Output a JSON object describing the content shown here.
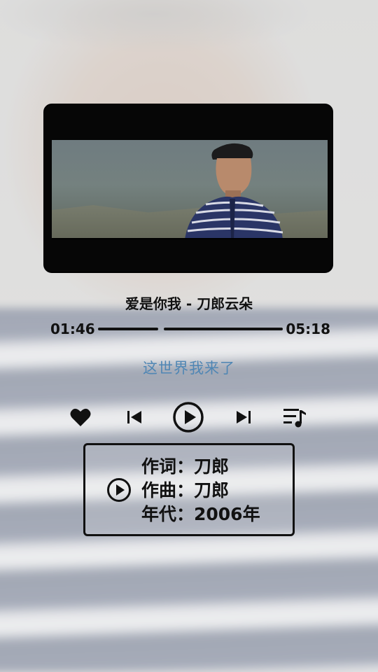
{
  "song": {
    "title": "爱是你我 - 刀郎云朵",
    "current_time": "01:46",
    "total_time": "05:18",
    "progress_fraction": 0.34,
    "lyric": "这世界我来了"
  },
  "controls": {
    "icons": [
      "heart-icon",
      "previous-icon",
      "play-icon",
      "next-icon",
      "playlist-icon"
    ]
  },
  "info": {
    "lyricist": "作词：刀郎",
    "composer": "作曲：刀郎",
    "year": "年代：2006年"
  },
  "colors": {
    "lyric": "#4f86b4",
    "text": "#111111"
  }
}
